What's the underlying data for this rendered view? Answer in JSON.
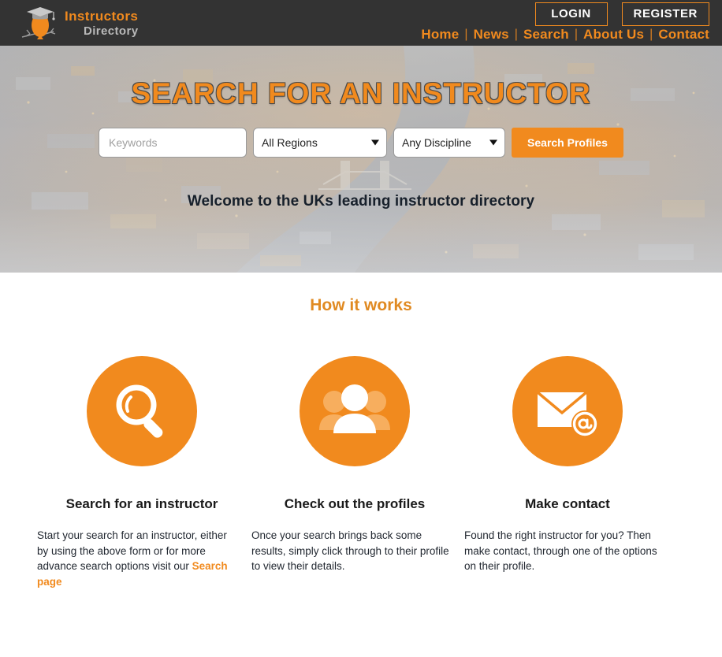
{
  "site": {
    "logo_line1": "Instructors",
    "logo_line2": "Directory",
    "logo_icon": "owl-graduate-icon"
  },
  "header": {
    "login_label": "LOGIN",
    "register_label": "REGISTER",
    "nav": [
      {
        "label": "Home"
      },
      {
        "label": "News"
      },
      {
        "label": "Search"
      },
      {
        "label": "About Us"
      },
      {
        "label": "Contact"
      }
    ],
    "separator": "|"
  },
  "hero": {
    "title": "SEARCH FOR AN INSTRUCTOR",
    "tagline": "Welcome to the UKs leading instructor directory",
    "search": {
      "keywords_placeholder": "Keywords",
      "keywords_value": "",
      "region_selected": "All Regions",
      "region_options": [
        "All Regions"
      ],
      "discipline_selected": "Any Discipline",
      "discipline_options": [
        "Any Discipline"
      ],
      "submit_label": "Search Profiles"
    },
    "background": "aerial-night-cityscape"
  },
  "how_it_works": {
    "title": "How it works",
    "columns": [
      {
        "icon": "magnifier-icon",
        "title": "Search for an instructor",
        "body": "Start your search for an instructor, either by using the above form or for more advance search options visit our ",
        "link_label": "Search page"
      },
      {
        "icon": "users-group-icon",
        "title": "Check out the profiles",
        "body": "Once your search brings back some results, simply click through to their profile to view their details.",
        "link_label": ""
      },
      {
        "icon": "envelope-at-icon",
        "title": "Make contact",
        "body": "Found the right instructor for you? Then make contact, through one of the options on their profile.",
        "link_label": ""
      }
    ]
  },
  "colors": {
    "brand_orange": "#F18A1E",
    "header_dark": "#333333",
    "logo_grey": "#b9b9b9",
    "text_dark": "#1a1a1a"
  }
}
